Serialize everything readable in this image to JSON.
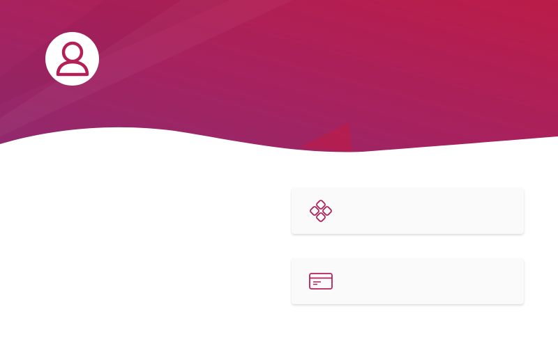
{
  "colors": {
    "hero_start": "#9c2566",
    "hero_end": "#bb1c48",
    "accent": "#b32058",
    "card_background": "#fafafa"
  },
  "header": {
    "avatar_icon": "user-icon"
  },
  "cards": [
    {
      "icon": "four-diamond-icon",
      "label": ""
    },
    {
      "icon": "credit-card-icon",
      "label": ""
    }
  ]
}
